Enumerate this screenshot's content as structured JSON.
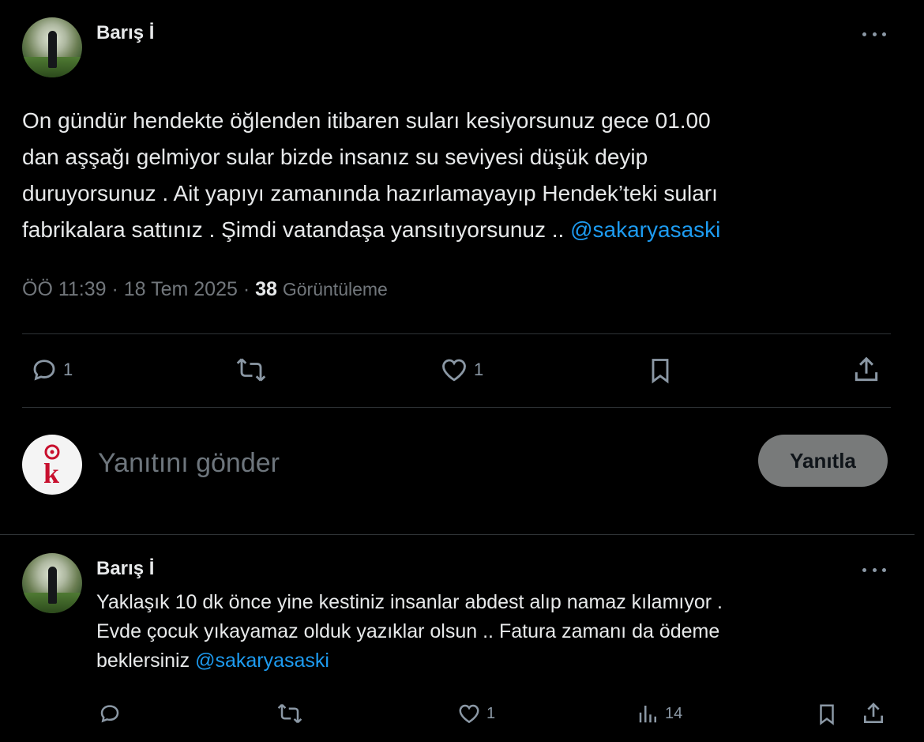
{
  "main_tweet": {
    "author_name": "Barış İ",
    "text": "On gündür hendekte öğlenden itibaren suları kesiyorsunuz gece 01.00\ndan  aşşağı gelmiyor sular bizde insanız su seviyesi düşük deyip\nduruyorsunuz . Ait yapıyı zamanında hazırlamayayıp Hendek’teki suları\nfabrikalara sattınız . Şimdi vatandaşa yansıtıyorsunuz .. ",
    "mention": "@sakaryasaski",
    "time": "ÖÖ 11:39",
    "date": "18 Tem 2025",
    "separator": "·",
    "views_count": "38",
    "views_label": "Görüntüleme",
    "actions": {
      "reply_icon": "reply-icon",
      "reply_count": "1",
      "retweet_icon": "retweet-icon",
      "like_icon": "heart-icon",
      "like_count": "1",
      "bookmark_icon": "bookmark-icon",
      "share_icon": "share-icon"
    }
  },
  "composer": {
    "placeholder": "Yanıtını gönder",
    "reply_button": "Yanıtla",
    "avatar_letter": "k"
  },
  "reply_tweet": {
    "author_name": "Barış İ",
    "text": "Yaklaşık 10 dk önce yine kestiniz insanlar abdest alıp namaz kılamıyor .\nEvde çocuk yıkayamaz  olduk yazıklar olsun ..  Fatura zamanı da ödeme\nbeklersiniz ",
    "mention": "@sakaryasaski",
    "actions": {
      "reply_icon": "reply-icon",
      "retweet_icon": "retweet-icon",
      "like_icon": "heart-icon",
      "like_count": "1",
      "views_icon": "views-icon",
      "views_count": "14",
      "bookmark_icon": "bookmark-icon",
      "share_icon": "share-icon"
    }
  },
  "colors": {
    "background": "#000000",
    "text": "#e7e9ea",
    "muted": "#71767b",
    "accent": "#1d9bf0",
    "divider": "#2f3336",
    "button_bg": "#787a7a",
    "brand_red": "#c8102e"
  }
}
